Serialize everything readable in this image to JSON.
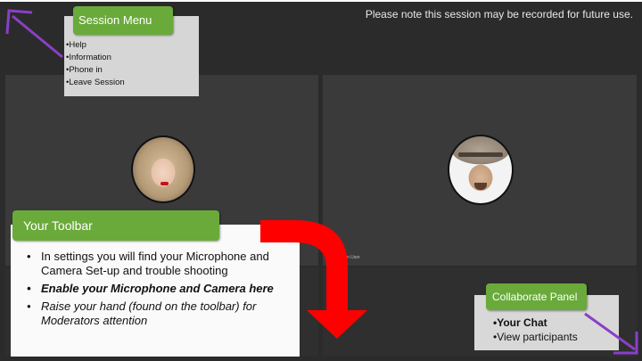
{
  "notice": "Please note this session may be recorded for future use.",
  "video": {
    "right_tile_name_fragment": "n User"
  },
  "session_menu": {
    "title": "Session Menu",
    "items": [
      "Help",
      "Information",
      "Phone in",
      "Leave Session"
    ]
  },
  "toolbar_callout": {
    "title": "Your Toolbar",
    "items": [
      "In settings you will find your Microphone and Camera Set-up and trouble shooting",
      "Enable your Microphone and Camera here",
      "Raise your hand (found on the toolbar) for Moderators attention"
    ]
  },
  "collaborate_panel": {
    "title": "Collaborate Panel",
    "items": [
      "Your Chat",
      "View participants"
    ]
  },
  "colors": {
    "accent_green": "#6aaa3a",
    "arrow_red": "#ff0000",
    "pointer_purple": "#8a3fc8"
  },
  "icons": [
    "session-menu-pointer-arrow-icon",
    "toolbar-curved-arrow-icon",
    "collaborate-pointer-arrow-icon"
  ]
}
